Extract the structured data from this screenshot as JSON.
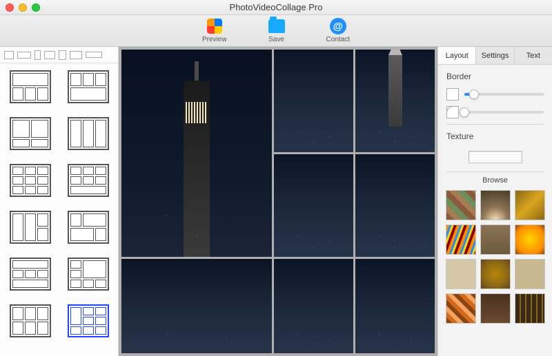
{
  "window": {
    "title": "PhotoVideoCollage Pro"
  },
  "toolbar": {
    "preview": "Preview",
    "save": "Save",
    "contact": "Contact",
    "contact_glyph": "@"
  },
  "left": {
    "aspect_presets": [
      "square",
      "wide",
      "portrait-tall",
      "landscape",
      "portrait",
      "landscape-2",
      "panorama"
    ],
    "templates": [
      {
        "id": "t1",
        "grid": "1fr 1fr / 1fr 1fr 1fr",
        "cells": 4,
        "style": "rows:1fr 1fr;cols:1fr 1fr 1fr"
      },
      {
        "id": "t2"
      },
      {
        "id": "t3"
      },
      {
        "id": "t4"
      },
      {
        "id": "t5"
      },
      {
        "id": "t6"
      },
      {
        "id": "t7"
      },
      {
        "id": "t8"
      },
      {
        "id": "t9"
      },
      {
        "id": "t10"
      },
      {
        "id": "t11"
      },
      {
        "id": "t12",
        "selected": true
      }
    ]
  },
  "right": {
    "tabs": {
      "layout": "Layout",
      "settings": "Settings",
      "text": "Text",
      "active": "layout"
    },
    "border": {
      "label": "Border",
      "width_pct": 12,
      "radius_pct": 0
    },
    "texture": {
      "label": "Texture"
    },
    "browse": {
      "label": "Browse"
    },
    "textures": [
      "diamond-retro",
      "sunburst-sepia",
      "gold-grunge",
      "rainbow-stripes",
      "brown-paper",
      "gold-burst",
      "parchment",
      "bronze-radial",
      "cream-paper",
      "diagonal-warm",
      "dark-leather",
      "film-strip"
    ]
  }
}
